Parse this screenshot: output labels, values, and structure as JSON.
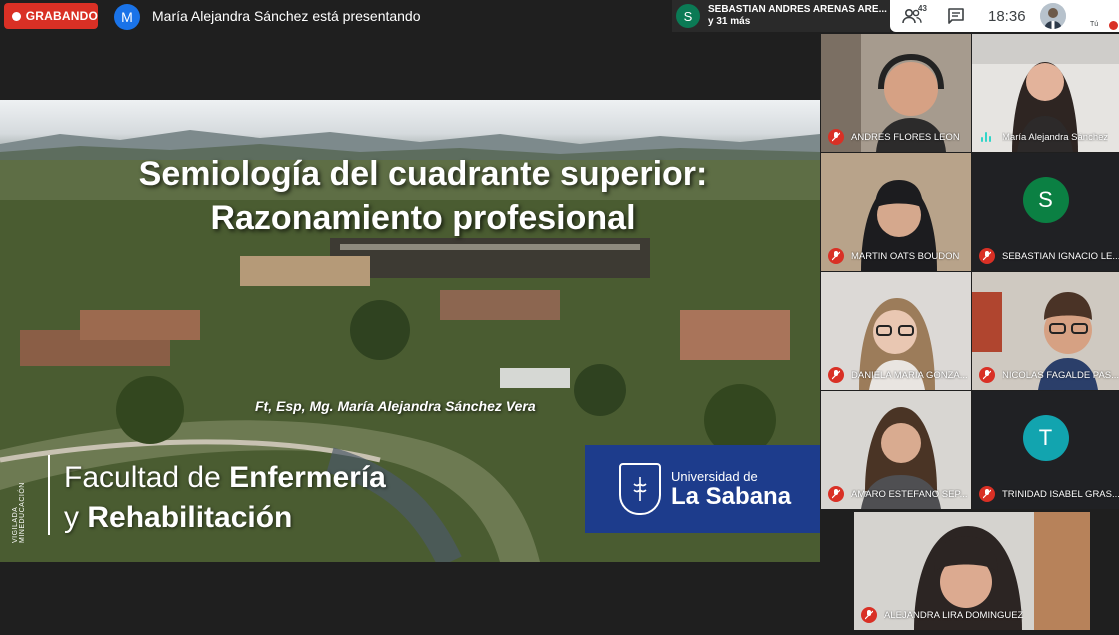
{
  "top_bar": {
    "recording_label": "GRABANDO",
    "presenter_initial": "M",
    "presenter_text": "María Alejandra Sánchez está presentando",
    "participants_chip": {
      "initial": "S",
      "line1": "SEBASTIAN ANDRES ARENAS ARE...",
      "line2": "y 31 más"
    }
  },
  "toolbar": {
    "participant_count": "43",
    "clock": "18:36",
    "self_label": "Tú"
  },
  "slide": {
    "title_line1": "Semiología del cuadrante superior:",
    "title_line2": "Razonamiento profesional",
    "author": "Ft, Esp, Mg. María Alejandra Sánchez Vera",
    "faculty_line1_prefix": "Facultad de ",
    "faculty_line1_bold": "Enfermería",
    "faculty_line2_prefix": "y ",
    "faculty_line2_bold": "Rehabilitación",
    "side_motto": "VIGILADA MINEDUCACIÓN",
    "logo_line1": "Universidad de",
    "logo_line2": "La Sabana"
  },
  "participants": [
    {
      "name": "ANDRES FLORES LEON",
      "muted": true
    },
    {
      "name": "María Alejandra Sánchez",
      "muted": false,
      "speaking": true
    },
    {
      "name": "MARTIN OATS BOUDON",
      "muted": true
    },
    {
      "name": "SEBASTIAN IGNACIO LE...",
      "muted": true,
      "initial": "S",
      "avatar_color": "#0b8043"
    },
    {
      "name": "DANIELA MARIA GONZA...",
      "muted": true
    },
    {
      "name": "NICOLAS FAGALDE PAS...",
      "muted": true
    },
    {
      "name": "AMARO ESTEFANO SEP...",
      "muted": true
    },
    {
      "name": "TRINIDAD ISABEL GRAS...",
      "muted": true,
      "initial": "T",
      "avatar_color": "#12a4af"
    },
    {
      "name": "ALEJANDRA LIRA DOMINGUEZ",
      "muted": true
    }
  ]
}
